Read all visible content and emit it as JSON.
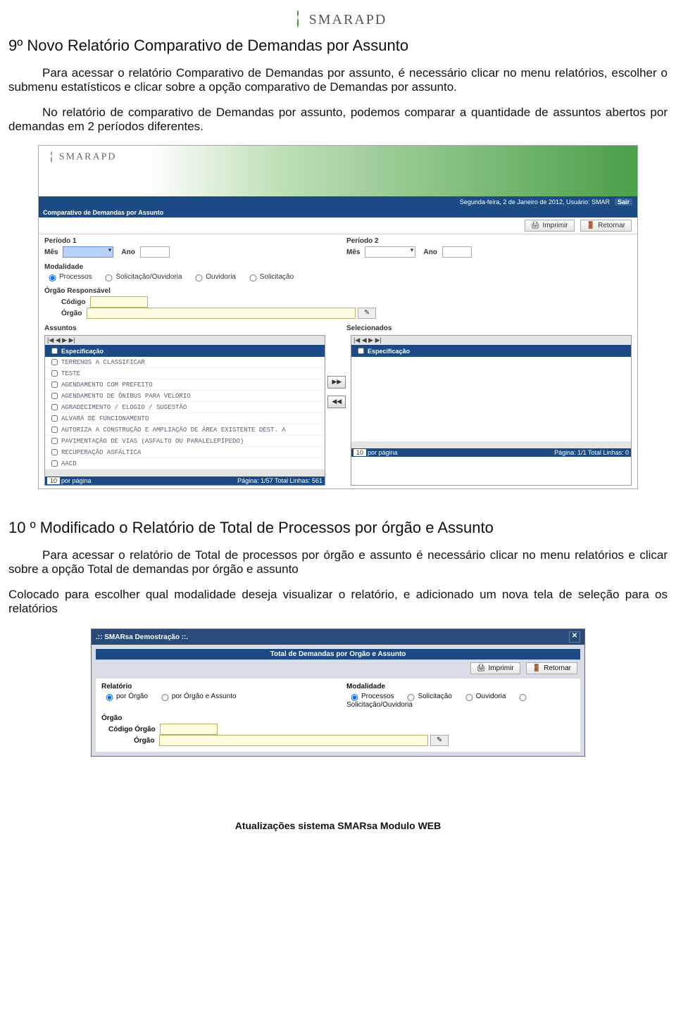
{
  "logo_text": "SMARAPD",
  "section1": {
    "title": "9º Novo Relatório Comparativo de Demandas por Assunto",
    "p1": "Para acessar o relatório Comparativo de Demandas por assunto, é necessário clicar no menu relatórios, escolher o submenu estatísticos e clicar sobre a opção comparativo de Demandas por assunto.",
    "p2": "No relatório de comparativo de Demandas por assunto, podemos comparar a quantidade de assuntos abertos por demandas em 2 períodos diferentes."
  },
  "shot1": {
    "topbar_text": "Segunda-feira, 2 de Janeiro de 2012, Usuário: SMAR",
    "sair": "Sair",
    "subbar": "Comparativo de Demandas por Assunto",
    "btn_print": "Imprimir",
    "btn_back": "Retornar",
    "periodo1": "Período 1",
    "periodo2": "Período 2",
    "mes": "Mês",
    "ano": "Ano",
    "modalidade": "Modalidade",
    "m_opts": [
      "Processos",
      "Solicitação/Ouvidoria",
      "Ouvidoria",
      "Solicitação"
    ],
    "orgao_resp": "Órgão Responsável",
    "codigo": "Código",
    "orgao": "Órgão",
    "assuntos": "Assuntos",
    "selecionados": "Selecionados",
    "col_head": "Especificação",
    "list": [
      "TERRENOS A CLASSIFICAR",
      "TESTE",
      "AGENDAMENTO COM PREFEITO",
      "AGENDAMENTO DE ÔNIBUS PARA VELÓRIO",
      "AGRADECIMENTO / ELOGIO / SUGESTÃO",
      "ALVARÁ DE FUNCIONAMENTO",
      "AUTORIZA A CONSTRUÇÃO E AMPLIAÇÃO DE ÁREA EXISTENTE DEST. A",
      "PAVIMENTAÇÃO DE VIAS (ASFALTO OU PARALELEPÍPEDO)",
      "RECUPERAÇÃO ASFÁLTICA",
      "AACD"
    ],
    "nav": "|◀  ◀  ▶  ▶|",
    "per_page_val": "10",
    "per_page_lbl": "por página",
    "page_left": "Página: 1/57 Total Linhas: 561",
    "page_right": "Página: 1/1 Total Linhas: 0"
  },
  "section2": {
    "title": "10 º Modificado o Relatório de Total de Processos por órgão e Assunto",
    "p1": "Para acessar o relatório de Total de processos por órgão e assunto é necessário clicar no menu relatórios e clicar sobre a opção Total de demandas por órgão e assunto",
    "p2": "Colocado para escolher qual modalidade deseja visualizar o relatório, e adicionado um nova tela de seleção para os relatórios"
  },
  "shot2": {
    "title": ".:: SMARsa Demostração ::.",
    "sub": "Total de Demandas por Orgão e Assunto",
    "btn_print": "Imprimir",
    "btn_back": "Retornar",
    "relatorio": "Relatório",
    "r_opts": [
      "por Órgão",
      "por Órgão e Assunto"
    ],
    "modalidade": "Modalidade",
    "m_opts": [
      "Processos",
      "Solicitação",
      "Ouvidoria",
      "Solicitação/Ouvidoria"
    ],
    "orgao": "Órgão",
    "codigo_orgao": "Código Órgão",
    "orgao_lbl": "Órgão"
  },
  "footer": "Atualizações sistema SMARsa Modulo WEB"
}
